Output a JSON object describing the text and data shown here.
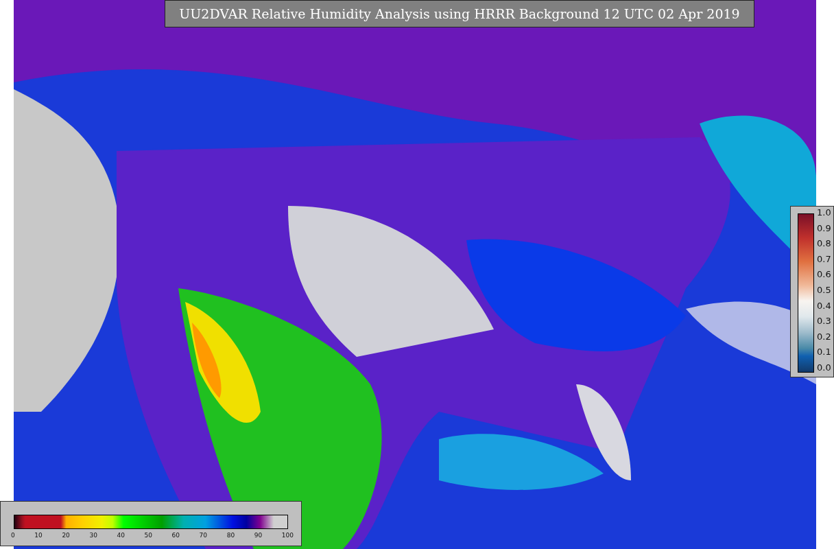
{
  "title": "UU2DVAR Relative Humidity Analysis using HRRR Background 12 UTC 02 Apr 2019",
  "error_legend": {
    "ticks": [
      "1.0",
      "0.9",
      "0.8",
      "0.7",
      "0.6",
      "0.5",
      "0.4",
      "0.3",
      "0.2",
      "0.1",
      "0.0"
    ]
  },
  "humidity_legend": {
    "ticks": [
      "0",
      "10",
      "20",
      "30",
      "40",
      "50",
      "60",
      "70",
      "80",
      "90",
      "100"
    ]
  }
}
